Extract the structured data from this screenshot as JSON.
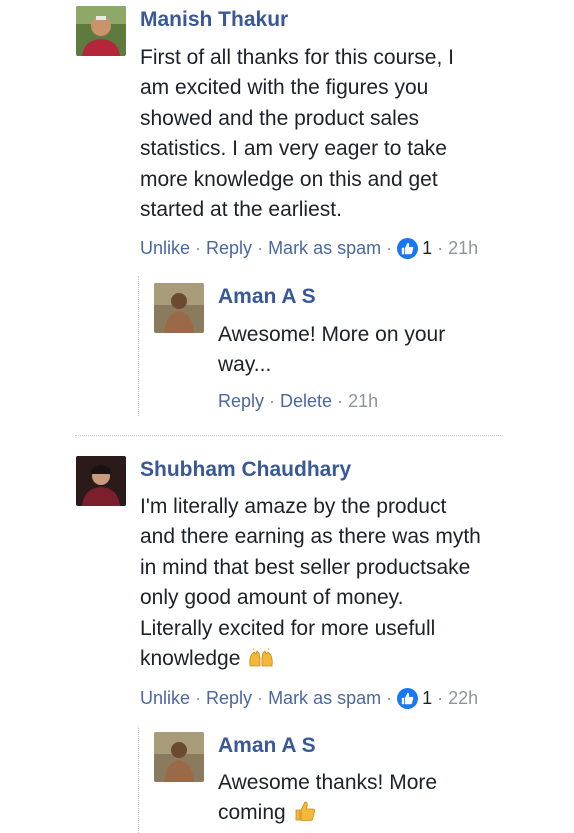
{
  "comments": [
    {
      "author": "Manish Thakur",
      "text": "First of all thanks for this course, I\nam excited with the figures you\nshowed and the product sales\nstatistics. I am very eager to take\nmore knowledge on this and get\nstarted at the earliest.",
      "actions": {
        "unlike": "Unlike",
        "reply": "Reply",
        "spam": "Mark as spam",
        "likes": "1",
        "time": "21h"
      },
      "reply": {
        "author": "Aman A S",
        "text": "Awesome! More on your\nway...",
        "actions": {
          "reply": "Reply",
          "delete": "Delete",
          "time": "21h"
        }
      }
    },
    {
      "author": "Shubham Chaudhary",
      "text": "I'm literally amaze by the product\nand there earning as there was myth\nin mind that best seller productsake\nonly good amount of money.\nLiterally excited for more usefull\nknowledge",
      "emoji": "raising-hands-emoji",
      "actions": {
        "unlike": "Unlike",
        "reply": "Reply",
        "spam": "Mark as spam",
        "likes": "1",
        "time": "22h"
      },
      "reply": {
        "author": "Aman A S",
        "text": "Awesome thanks! More\ncoming",
        "emoji": "thumbs-up-emoji"
      }
    }
  ],
  "colors": {
    "link": "#385898",
    "action": "#4b67a1",
    "muted": "#8d949e",
    "like": "#1877f2"
  }
}
